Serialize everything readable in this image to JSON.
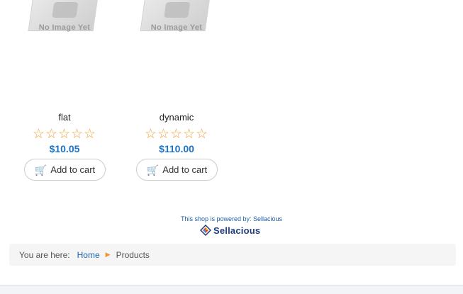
{
  "products": [
    {
      "image_text": "No Image Yet",
      "title": "flat",
      "rating_stars": "☆☆☆☆☆",
      "rating_value": 0,
      "price": "$10.05",
      "cart_label": "Add to cart",
      "cart_icon": "shopping-cart-icon"
    },
    {
      "image_text": "No Image Yet",
      "title": "dynamic",
      "rating_stars": "☆☆☆☆☆",
      "rating_value": 0,
      "price": "$110.00",
      "cart_label": "Add to cart",
      "cart_icon": "shopping-cart-icon"
    }
  ],
  "footer": {
    "powered_by_prefix": "This shop is powered by:",
    "powered_by_link": "Sellacious",
    "logo_text": "Sellacious"
  },
  "breadcrumb": {
    "label": "You are here:",
    "home": "Home",
    "separator_icon": "caret-right-icon",
    "current": "Products"
  },
  "colors": {
    "price": "#1a73c9",
    "stars": "#f0a13a",
    "link": "#1a62b0",
    "breadcrumb_separator": "#f0962a",
    "logo_text": "#1d3d7c"
  }
}
